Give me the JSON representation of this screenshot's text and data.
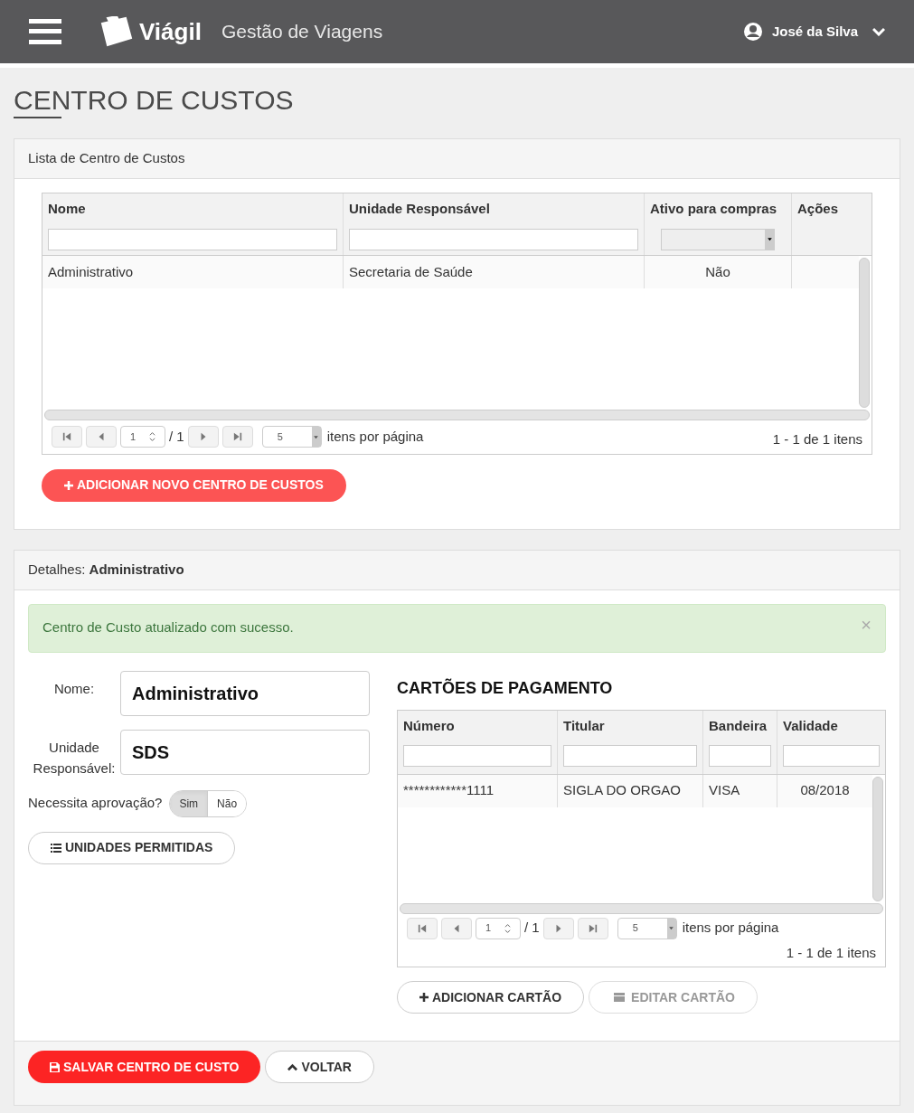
{
  "header": {
    "brand": "Viágil",
    "subtitle": "Gestão de Viagens",
    "user": "José da Silva"
  },
  "page_title": "CENTRO DE CUSTOS",
  "list_panel": {
    "title": "Lista de Centro de Custos",
    "table": {
      "columns": [
        {
          "label": "Nome",
          "kind": "text"
        },
        {
          "label": "Unidade Responsável",
          "kind": "text"
        },
        {
          "label": "Ativo para compras",
          "kind": "select"
        },
        {
          "label": "Ações",
          "kind": "plain"
        }
      ],
      "rows": [
        [
          "Administrativo",
          "Secretaria de Saúde",
          "Não"
        ]
      ]
    },
    "pager": {
      "page": "1",
      "total": "/ 1",
      "page_size": "5",
      "per_page_label": "itens por página",
      "summary": "1 - 1 de 1 itens"
    },
    "add_button": "ADICIONAR NOVO CENTRO DE CUSTOS"
  },
  "details_panel": {
    "title_prefix": "Detalhes:",
    "title_name": "Administrativo",
    "alert": {
      "message": "Centro de Custo atualizado com sucesso.",
      "close": "×"
    },
    "fields": [
      {
        "label": "Nome:",
        "value": "Administrativo"
      },
      {
        "label": "Unidade Responsável:",
        "value": "SDS"
      }
    ],
    "approval": {
      "label": "Necessita aprovação?",
      "options": [
        {
          "label": "Sim",
          "selected": true
        },
        {
          "label": "Não",
          "selected": false
        }
      ]
    },
    "units_button": "UNIDADES PERMITIDAS",
    "cards": {
      "title": "CARTÕES DE PAGAMENTO",
      "table": {
        "columns": [
          {
            "label": "Número",
            "kind": "text"
          },
          {
            "label": "Titular",
            "kind": "text"
          },
          {
            "label": "Bandeira",
            "kind": "text"
          },
          {
            "label": "Validade",
            "kind": "text"
          }
        ],
        "rows": [
          [
            "************1111",
            "SIGLA DO ORGAO",
            "VISA",
            "08/2018"
          ]
        ]
      },
      "pager": {
        "page": "1",
        "total": "/ 1",
        "page_size": "5",
        "per_page_label": "itens por página",
        "summary": "1 - 1 de 1 itens"
      },
      "buttons": [
        {
          "label": "ADICIONAR CARTÃO",
          "kind": "add",
          "disabled": false
        },
        {
          "label": "EDITAR CARTÃO",
          "kind": "edit",
          "disabled": true
        }
      ]
    }
  },
  "footer_buttons": [
    {
      "label": "SALVAR CENTRO DE CUSTO",
      "kind": "save"
    },
    {
      "label": "VOLTAR",
      "kind": "back"
    }
  ]
}
